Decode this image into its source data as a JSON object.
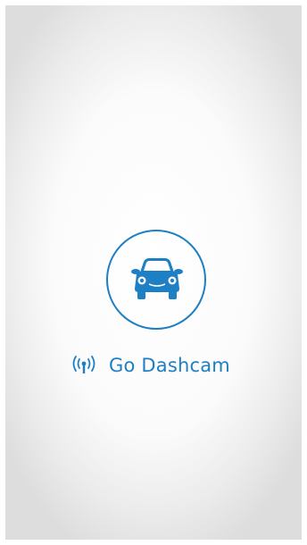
{
  "app": {
    "name": "Go Dashcam",
    "accent_color": "#1d7fc4",
    "logo_icon": "car-front-icon",
    "signal_icon": "wifi-signal-icon"
  }
}
